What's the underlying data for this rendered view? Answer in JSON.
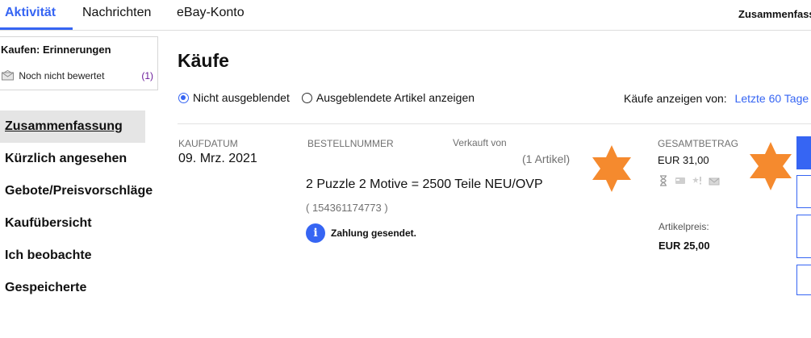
{
  "tabs": [
    {
      "label": "Aktivität"
    },
    {
      "label": "Nachrichten"
    },
    {
      "label": "eBay-Konto"
    }
  ],
  "summary_link": "Zusammenfassu",
  "reminders": {
    "title": "Kaufen: Erinnerungen",
    "item_label": "Noch nicht bewertet",
    "item_count": "(1)"
  },
  "sidenav": {
    "items": [
      {
        "label": "Zusammenfassung"
      },
      {
        "label": "Kürzlich angesehen"
      },
      {
        "label": "Gebote/Preisvorschläge"
      },
      {
        "label": "Kaufübersicht"
      },
      {
        "label": "Ich beobachte"
      },
      {
        "label": "Gespeicherte"
      }
    ]
  },
  "main": {
    "title": "Käufe",
    "filter_shown": "Nicht ausgeblendet",
    "filter_hidden": "Ausgeblendete Artikel anzeigen",
    "period_label": "Käufe anzeigen von:",
    "period_value": "Letzte 60 Tage"
  },
  "order": {
    "date_label": "KAUFDATUM",
    "date": "09. Mrz. 2021",
    "order_number_label": "BESTELLNUMMER",
    "sold_by_label": "Verkauft von",
    "items_count": "(1 Artikel)",
    "item_title": "2 Puzzle 2 Motive = 2500 Teile NEU/OVP",
    "item_id": "( 154361174773 )",
    "status": "Zahlung gesendet.",
    "total_label": "GESAMTBETRAG",
    "total": "EUR 31,00",
    "price_label": "Artikelpreis:",
    "price": "EUR 25,00"
  },
  "colors": {
    "accent": "#3665f3",
    "redaction_star": "#f58a2e",
    "reminder_count": "#6a1b9a"
  },
  "icons": [
    "envelope-icon",
    "info-icon",
    "hourglass-icon",
    "payment-icon",
    "feedback-star-icon",
    "shipping-envelope-icon",
    "star-redaction-icon"
  ]
}
